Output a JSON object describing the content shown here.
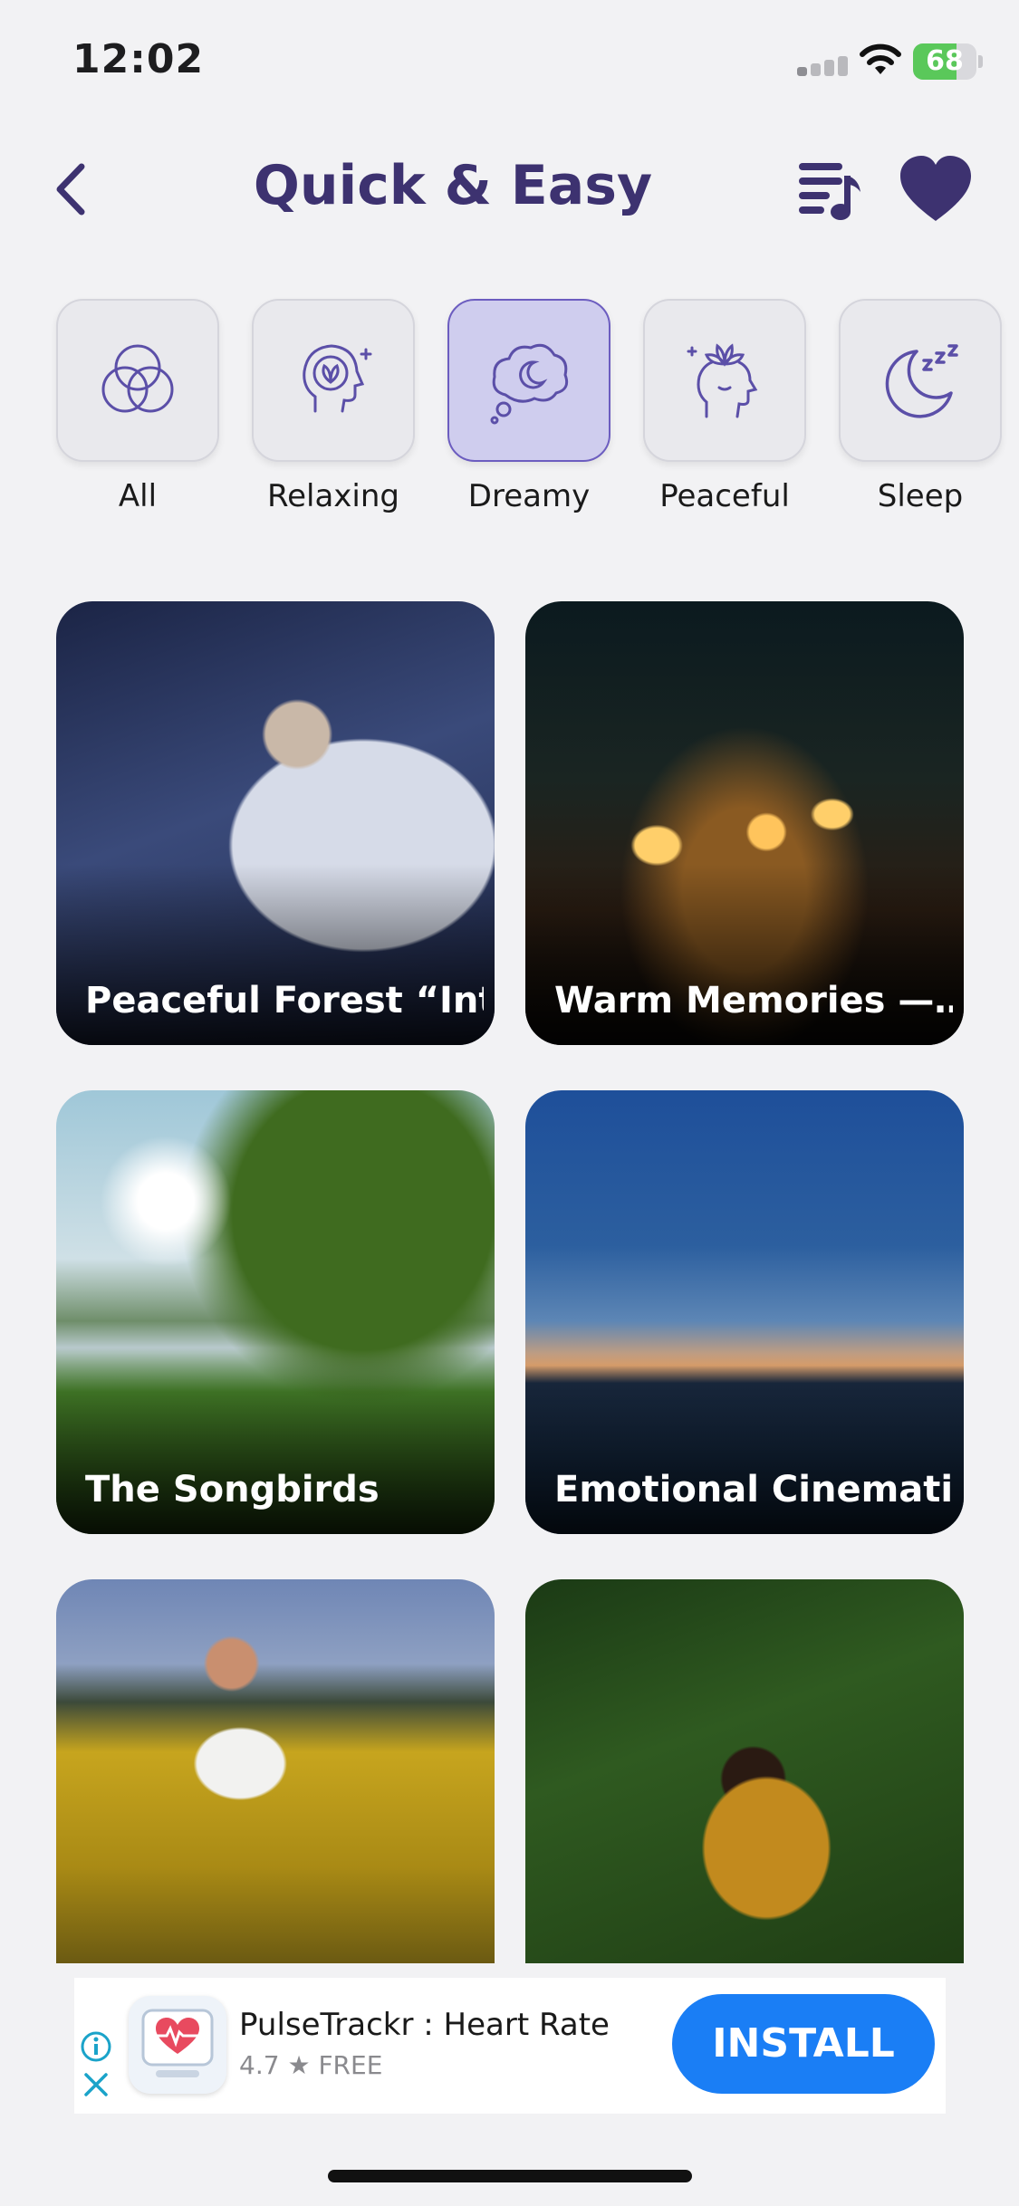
{
  "status_bar": {
    "time": "12:02",
    "battery": "68"
  },
  "header": {
    "title": "Quick & Easy"
  },
  "categories": [
    {
      "label": "All",
      "icon": "circles-icon",
      "selected": false
    },
    {
      "label": "Relaxing",
      "icon": "head-lotus-icon",
      "selected": false
    },
    {
      "label": "Dreamy",
      "icon": "cloud-moon-icon",
      "selected": true
    },
    {
      "label": "Peaceful",
      "icon": "mind-lotus-icon",
      "selected": false
    },
    {
      "label": "Sleep",
      "icon": "moon-zzz-icon",
      "selected": false
    }
  ],
  "tracks": [
    {
      "title": "Peaceful Forest “Int…"
    },
    {
      "title": "Warm Memories —…"
    },
    {
      "title": "The Songbirds"
    },
    {
      "title": "Emotional Cinemati…"
    },
    {
      "title": ""
    },
    {
      "title": ""
    }
  ],
  "ad": {
    "app_name": "PulseTrackr : Heart Rate",
    "rating": "4.7",
    "price": "FREE",
    "install_label": "INSTALL"
  },
  "colors": {
    "accent": "#3d3270",
    "selected_tile": "#cfcdee",
    "install": "#1a7ef5"
  }
}
